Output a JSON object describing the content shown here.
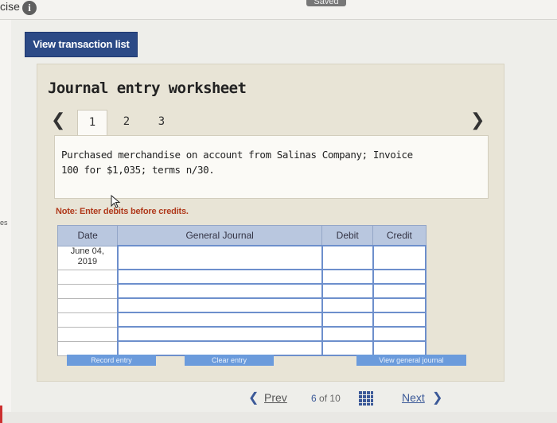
{
  "topbar": {
    "title_fragment": "cise",
    "saved": "Saved"
  },
  "left_rail": {
    "tab_fragment": "es"
  },
  "view_transaction_list": "View transaction list",
  "worksheet": {
    "title": "Journal entry worksheet",
    "tabs": [
      "1",
      "2",
      "3"
    ],
    "active_tab": 0,
    "description": "Purchased merchandise on account from Salinas Company; Invoice 100 for $1,035; terms n/30.",
    "note": "Note: Enter debits before credits."
  },
  "journal_table": {
    "headers": {
      "date": "Date",
      "general_journal": "General Journal",
      "debit": "Debit",
      "credit": "Credit"
    },
    "first_date": "June 04, 2019",
    "empty_rows": 6
  },
  "buttons": {
    "record_entry": "Record entry",
    "clear_entry": "Clear entry",
    "view_general_journal": "View general journal"
  },
  "footer": {
    "prev": "Prev",
    "current_page": "6",
    "of_label": "of",
    "total_pages": "10",
    "next": "Next"
  },
  "colors": {
    "primary_button": "#2c4a86",
    "table_header": "#b9c7df",
    "table_border": "#6d8fcc",
    "note_text": "#b03a1c",
    "action_button": "#6b9bdc"
  }
}
